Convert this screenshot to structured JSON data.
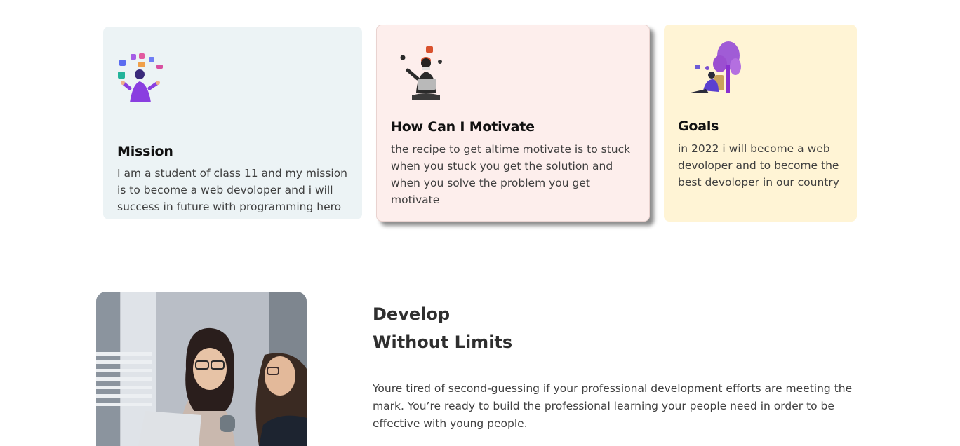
{
  "cards": [
    {
      "title": "Mission",
      "text": "I am a student of class 11 and my mission is to become a web devoloper and i will success in future with programming hero",
      "background": "#ecf3f5",
      "illustration": "juggling-app-icons-illustration"
    },
    {
      "title": "How Can I Motivate",
      "text": "the recipe to get altime motivate is to stuck when you stuck you get the solution and when you solve the problem you get motivate",
      "background": "#fdeeec",
      "illustration": "person-with-laptop-illustration"
    },
    {
      "title": "Goals",
      "text": "in 2022 i will become a web devoloper and to become the best devoloper in our country",
      "background": "#fff4d5",
      "illustration": "person-under-tree-illustration"
    }
  ],
  "develop": {
    "heading_line1": "Develop",
    "heading_line2": "Without Limits",
    "text": "Youre tired of second-guessing if your professional development efforts are meeting the mark. You’re ready to build the professional learning your people need in order to be effective with young people.",
    "image": "two-students-with-laptop-photo"
  }
}
